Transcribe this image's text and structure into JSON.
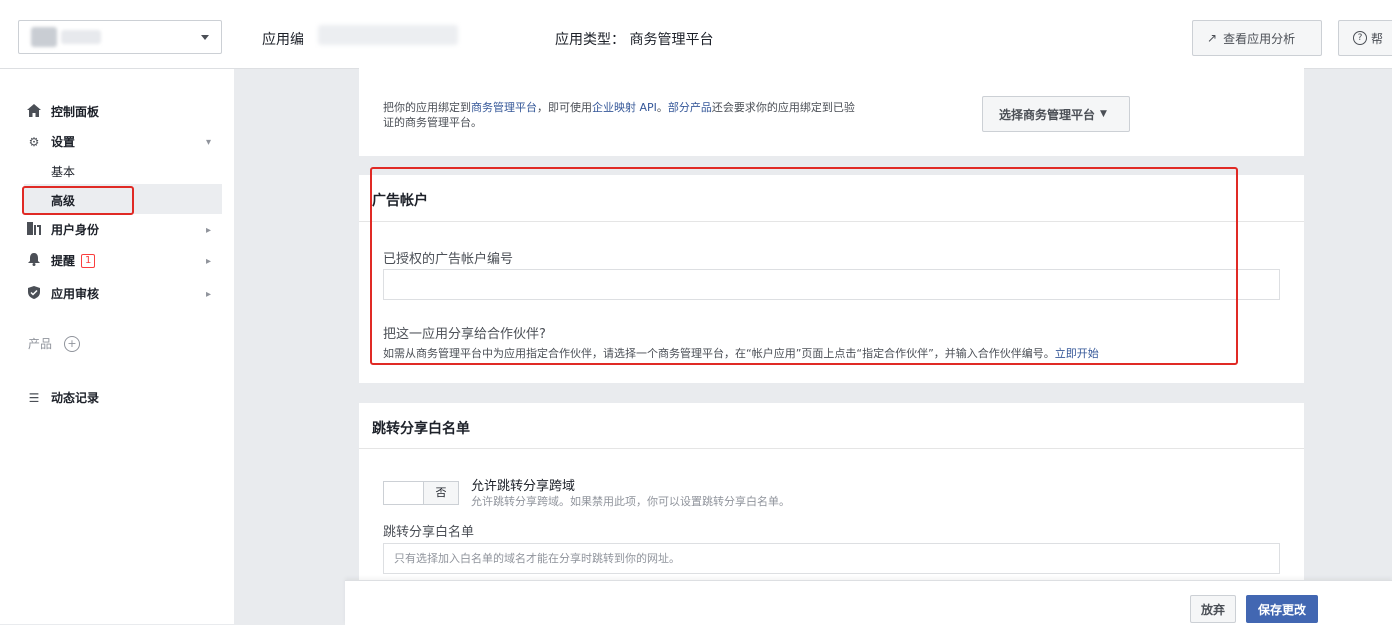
{
  "header": {
    "app_name_label": "应用编",
    "app_type_text": "应用类型： 商务管理平台",
    "analytics_button": "查看应用分析",
    "help_button": "帮"
  },
  "sidebar": {
    "dashboard": "控制面板",
    "settings": "设置",
    "settings_basic": "基本",
    "settings_advanced": "高级",
    "roles": "用户身份",
    "alerts": "提醒",
    "alerts_badge": "1",
    "app_review": "应用审核",
    "products": "产品",
    "activity_log": "动态记录"
  },
  "business_section": {
    "text_part1": "把你的应用绑定到",
    "link1": "商务管理平台",
    "text_part2": "，即可使用",
    "link2": "企业映射 API",
    "text_part3": "。",
    "link3": "部分产品",
    "text_part4": "还会要求你的应用绑定到已验证的商务管理平台。",
    "select_button": "选择商务管理平台"
  },
  "ad_accounts": {
    "title": "广告帐户",
    "authorized_label": "已授权的广告帐户编号",
    "authorized_value": "",
    "share_question": "把这一应用分享给合作伙伴?",
    "share_desc": "如需从商务管理平台中为应用指定合作伙伴，请选择一个商务管理平台，在“帐户应用”页面上点击“指定合作伙伴”，并输入合作伙伴编号。",
    "share_link": "立即开始"
  },
  "redirect_whitelist": {
    "title": "跳转分享白名单",
    "toggle_state": "否",
    "toggle_title": "允许跳转分享跨域",
    "toggle_desc": "允许跳转分享跨域。如果禁用此项，你可以设置跳转分享白名单。",
    "whitelist_label": "跳转分享白名单",
    "whitelist_placeholder": "只有选择加入白名单的域名才能在分享时跳转到你的网址。"
  },
  "footer": {
    "discard": "放弃",
    "save": "保存更改"
  },
  "colors": {
    "primary": "#4267b2",
    "link": "#365899",
    "highlight": "#e02a25"
  }
}
